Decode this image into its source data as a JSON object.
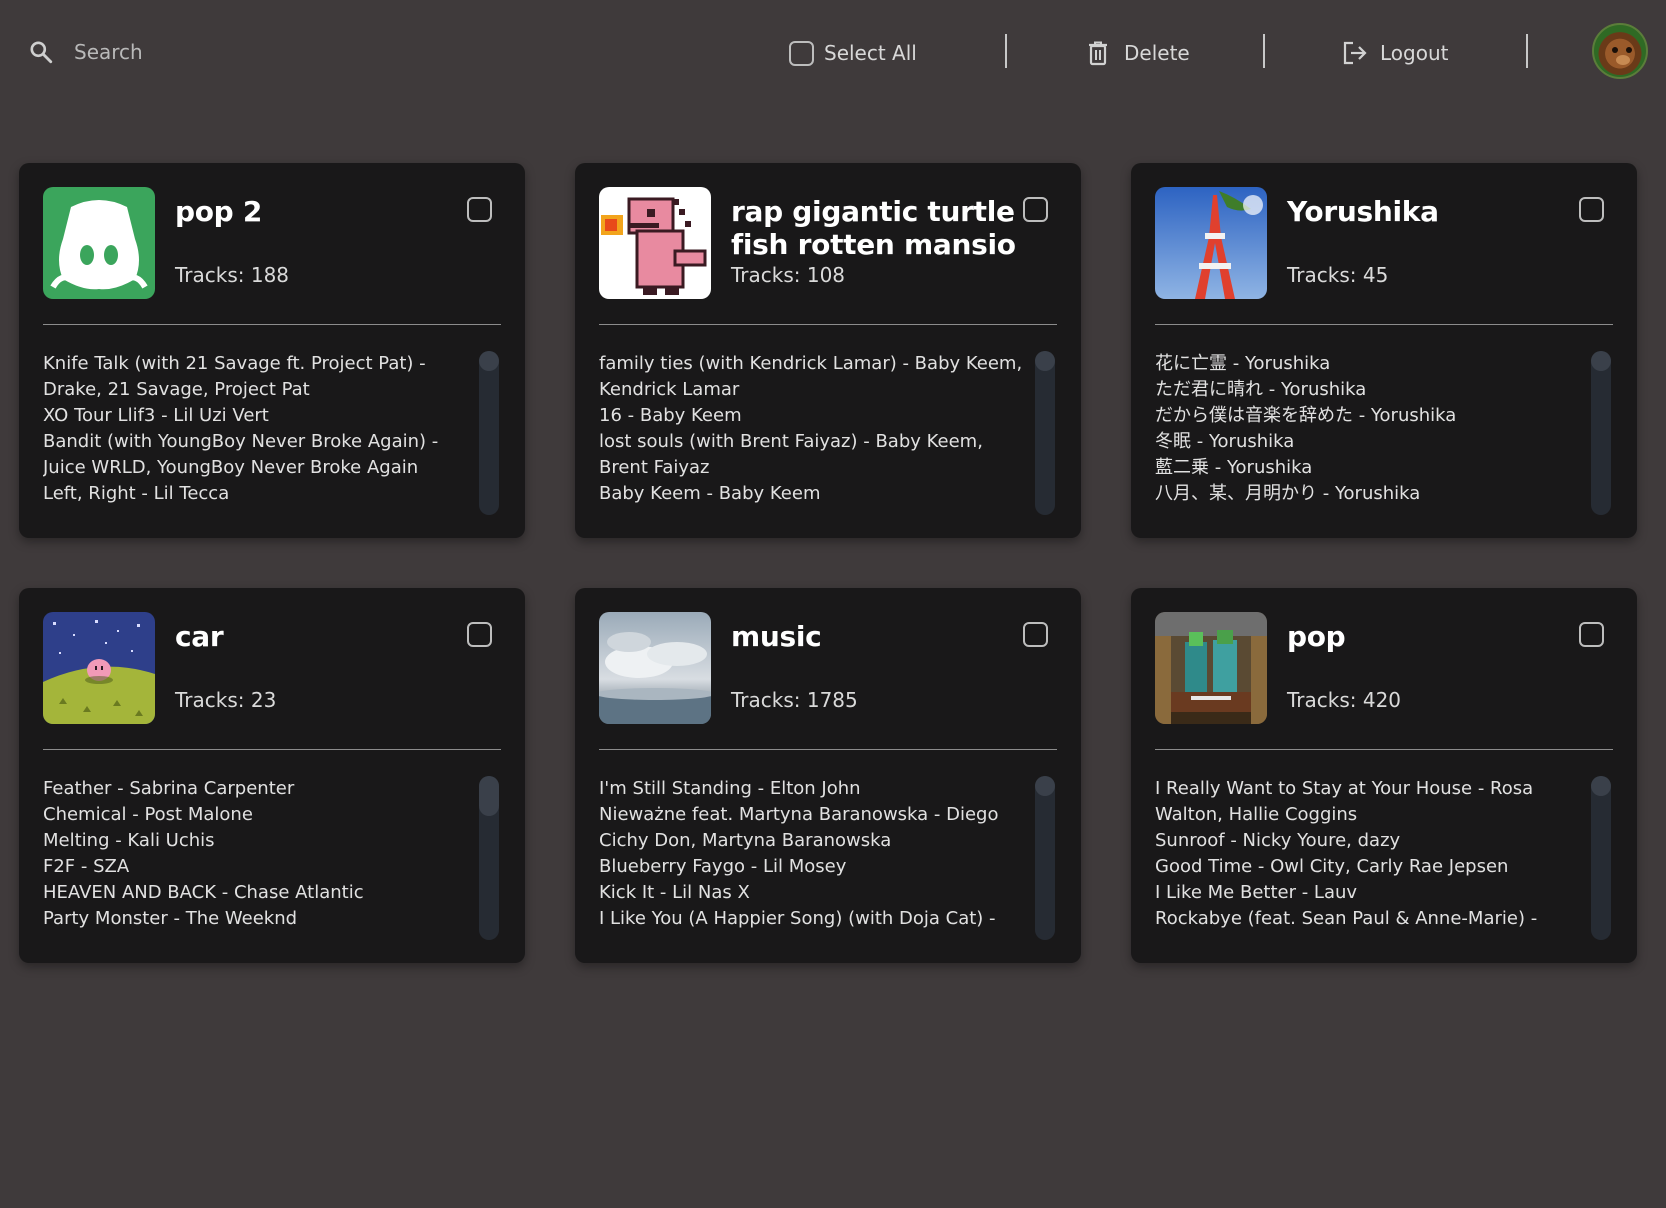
{
  "topbar": {
    "search_placeholder": "Search",
    "select_all_label": "Select All",
    "delete_label": "Delete",
    "logout_label": "Logout"
  },
  "playlists": [
    {
      "title": "pop 2",
      "tracks_label": "Tracks: 188",
      "art": "discord-logo",
      "art_color": "#3ba55c",
      "songs": [
        "Knife Talk (with 21 Savage ft. Project Pat) - Drake, 21 Savage, Project Pat",
        "XO Tour Llif3 - Lil Uzi Vert",
        "Bandit (with YoungBoy Never Broke Again) - Juice WRLD, YoungBoy Never Broke Again",
        "Left, Right - Lil Tecca"
      ]
    },
    {
      "title": "rap gigantic turtle fish rotten mansio",
      "tracks_label": "Tracks: 108",
      "art": "pixel-pink-dinosaur",
      "art_color": "#e88aa0",
      "songs": [
        "family ties (with Kendrick Lamar) - Baby Keem, Kendrick Lamar",
        "16 - Baby Keem",
        "lost souls (with Brent Faiyaz) - Baby Keem, Brent Faiyaz",
        "Baby Keem - Baby Keem"
      ]
    },
    {
      "title": "Yorushika",
      "tracks_label": "Tracks: 45",
      "art": "tokyo-tower-photo",
      "art_color": "#3f72c4",
      "songs": [
        "花に亡霊 - Yorushika",
        "ただ君に晴れ - Yorushika",
        "だから僕は音楽を辞めた - Yorushika",
        "冬眠 - Yorushika",
        "藍二乗 - Yorushika",
        "八月、某、月明かり - Yorushika"
      ]
    },
    {
      "title": "car",
      "tracks_label": "Tracks: 23",
      "art": "pixel-kirby-night-field",
      "art_color": "#2e3f8a",
      "songs": [
        "Feather - Sabrina Carpenter",
        "Chemical - Post Malone",
        "Melting - Kali Uchis",
        "F2F - SZA",
        "HEAVEN AND BACK - Chase Atlantic",
        "Party Monster - The Weeknd"
      ]
    },
    {
      "title": "music",
      "tracks_label": "Tracks: 1785",
      "art": "clouds-aerial-photo",
      "art_color": "#5d7384",
      "songs": [
        "I'm Still Standing - Elton John",
        "Nieważne feat. Martyna Baranowska - Diego Cichy Don, Martyna Baranowska",
        "Blueberry Faygo - Lil Mosey",
        "Kick It - Lil Nas X",
        "I Like You (A Happier Song) (with Doja Cat) - Post"
      ]
    },
    {
      "title": "pop",
      "tracks_label": "Tracks: 420",
      "art": "minecraft-scene",
      "art_color": "#5a4a33",
      "songs": [
        "I Really Want to Stay at Your House - Rosa Walton, Hallie Coggins",
        "Sunroof - Nicky Youre, dazy",
        "Good Time - Owl City, Carly Rae Jepsen",
        "I Like Me Better - Lauv",
        "Rockabye (feat. Sean Paul & Anne-Marie) - Clean"
      ]
    }
  ]
}
